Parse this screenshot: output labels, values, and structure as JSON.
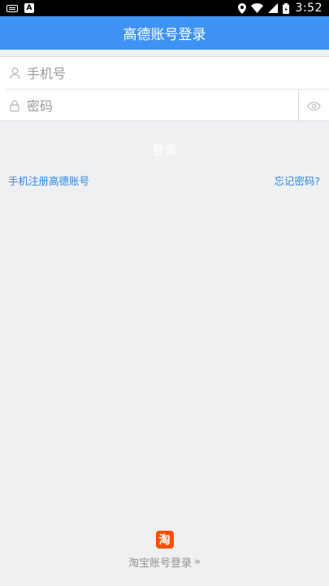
{
  "status_bar": {
    "time": "3:52",
    "icons": [
      "keyboard-icon",
      "a-icon",
      "location-icon",
      "wifi-icon",
      "signal-icon",
      "battery-icon"
    ]
  },
  "header": {
    "title": "高德账号登录"
  },
  "form": {
    "phone_placeholder": "手机号",
    "password_placeholder": "密码"
  },
  "actions": {
    "login_label": "登录",
    "register_link": "手机注册高德账号",
    "forgot_link": "忘记密码?"
  },
  "taobao": {
    "logo_char": "淘",
    "label": "淘宝账号登录",
    "arrow": "»"
  },
  "colors": {
    "header_bg": "#3f93f5",
    "link": "#2a86e0",
    "background": "#eff0f2",
    "taobao_orange": "#ff5000"
  }
}
